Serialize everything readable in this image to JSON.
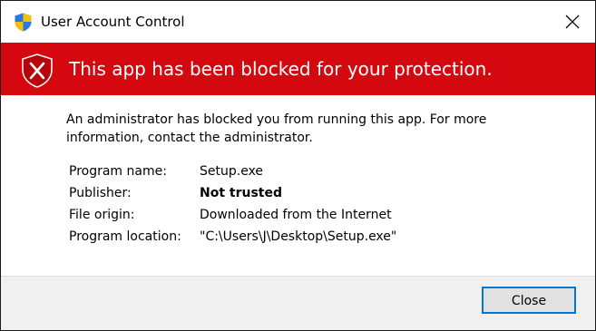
{
  "window": {
    "title": "User Account Control",
    "title_icon": "uac-shield-icon",
    "close_icon": "close-icon"
  },
  "banner": {
    "text": "This app has been blocked for your protection.",
    "icon": "blocked-shield-icon",
    "background_color": "#d4080e"
  },
  "message": {
    "line1": "An administrator has blocked you from running this app. For more",
    "line2": "information, contact the administrator."
  },
  "details": [
    {
      "label": "Program name:",
      "value": "Setup.exe",
      "bold": false
    },
    {
      "label": "Publisher:",
      "value": "Not trusted",
      "bold": true
    },
    {
      "label": "File origin:",
      "value": "Downloaded from the Internet",
      "bold": false
    },
    {
      "label": "Program location:",
      "value": "\"C:\\Users\\J\\Desktop\\Setup.exe\"",
      "bold": false
    }
  ],
  "footer": {
    "close_label": "Close"
  },
  "colors": {
    "accent": "#0078d7",
    "footer_bg": "#f0f0f0"
  }
}
